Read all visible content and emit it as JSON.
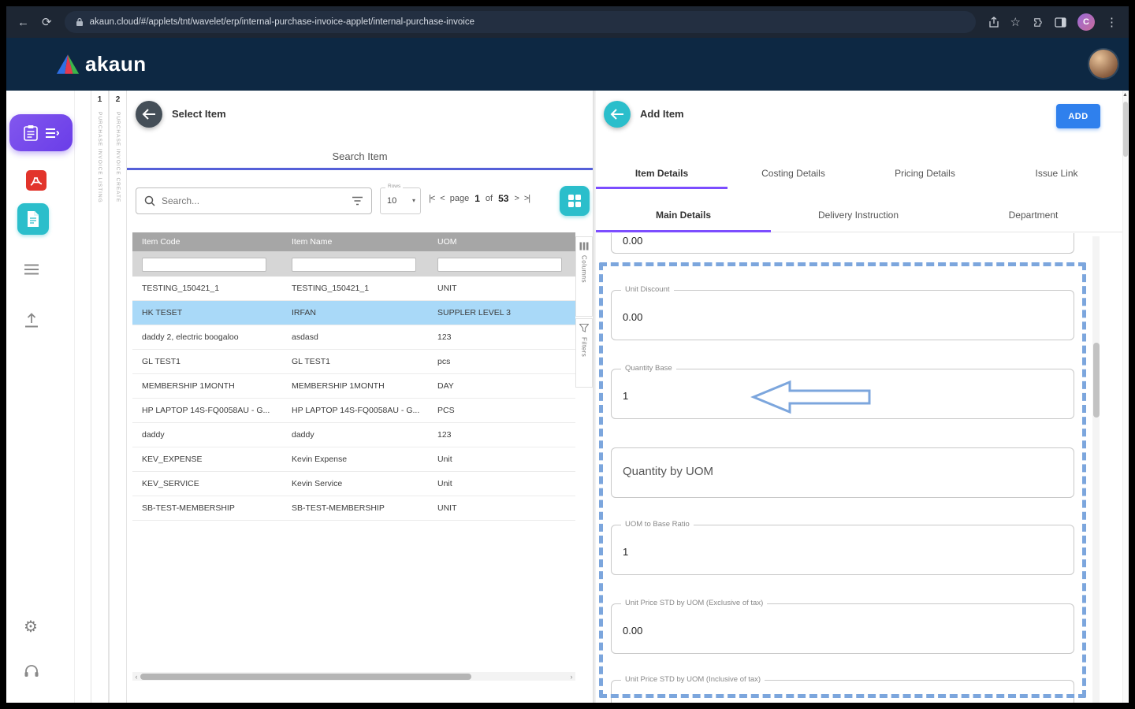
{
  "colors": {
    "accent_purple": "#7C4DFF",
    "teal": "#2BBECB",
    "primary_blue": "#2F80ED",
    "header_navy": "#0D2843",
    "selected_row": "#A9D9F8",
    "annotation_blue": "#7CA6DD"
  },
  "browser": {
    "url": "akaun.cloud/#/applets/tnt/wavelet/erp/internal-purchase-invoice-applet/internal-purchase-invoice",
    "profile_initial": "C"
  },
  "app": {
    "logo_text": "akaun"
  },
  "workflow_steps": [
    {
      "num": "1",
      "label": "PURCHASE INVOICE LISTING"
    },
    {
      "num": "2",
      "label": "PURCHASE INVOICE CREATE"
    }
  ],
  "select_item": {
    "title": "Select Item",
    "subtitle": "Search Item",
    "search_placeholder": "Search...",
    "rows_label": "Rows",
    "rows_value": "10",
    "pagination": {
      "page_word": "page",
      "current": "1",
      "of_word": "of",
      "total": "53"
    },
    "rail": {
      "columns": "Columns",
      "filters": "Filters"
    },
    "table": {
      "headers": [
        "Item Code",
        "Item Name",
        "UOM"
      ],
      "selected_index": 1,
      "rows": [
        [
          "TESTING_150421_1",
          "TESTING_150421_1",
          "UNIT"
        ],
        [
          "HK TESET",
          "IRFAN",
          "SUPPLER LEVEL 3"
        ],
        [
          "daddy 2, electric boogaloo",
          "asdasd",
          "123"
        ],
        [
          "GL TEST1",
          "GL TEST1",
          "pcs"
        ],
        [
          "MEMBERSHIP 1MONTH",
          "MEMBERSHIP 1MONTH",
          "DAY"
        ],
        [
          "HP LAPTOP 14S-FQ0058AU - G...",
          "HP LAPTOP 14S-FQ0058AU - G...",
          "PCS"
        ],
        [
          "daddy",
          "daddy",
          "123"
        ],
        [
          "KEV_EXPENSE",
          "Kevin Expense",
          "Unit"
        ],
        [
          "KEV_SERVICE",
          "Kevin Service",
          "Unit"
        ],
        [
          "SB-TEST-MEMBERSHIP",
          "SB-TEST-MEMBERSHIP",
          "UNIT"
        ]
      ]
    }
  },
  "add_item": {
    "title": "Add Item",
    "add_button": "ADD",
    "tabs": [
      "Item Details",
      "Costing Details",
      "Pricing Details",
      "Issue Link"
    ],
    "sub_tabs": [
      "Main Details",
      "Delivery Instruction",
      "Department"
    ],
    "top_partial_value": "0.00",
    "fields": {
      "unit_discount": {
        "label": "Unit Discount",
        "value": "0.00"
      },
      "quantity_base": {
        "label": "Quantity Base",
        "value": "1"
      },
      "quantity_by_uom": {
        "label": "Quantity by UOM"
      },
      "uom_to_base_ratio": {
        "label": "UOM to Base Ratio",
        "value": "1"
      },
      "unit_price_std_excl": {
        "label": "Unit Price STD by UOM (Exclusive of tax)",
        "value": "0.00"
      },
      "unit_price_std_incl": {
        "label": "Unit Price STD by UOM (Inclusive of tax)"
      }
    }
  }
}
